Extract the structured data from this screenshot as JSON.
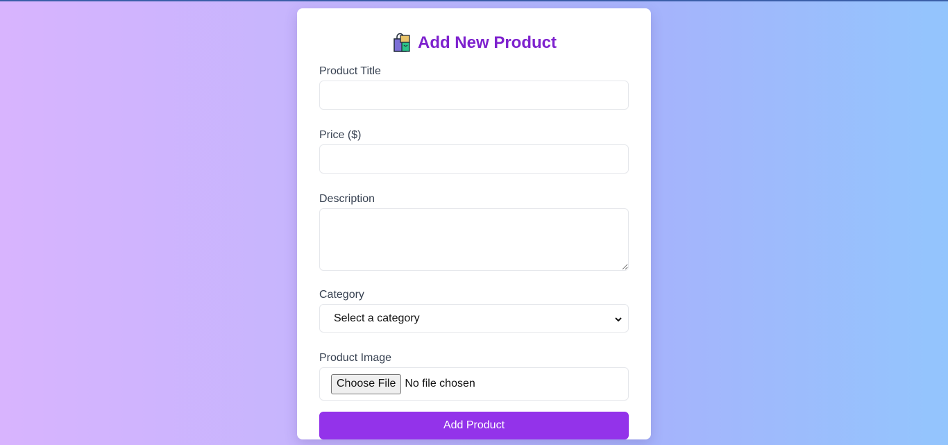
{
  "page": {
    "accent_color": "#9333ea",
    "title_color": "#7e22ce"
  },
  "form": {
    "title": "Add New Product",
    "title_icon": "shopping-bags-icon",
    "product_title": {
      "label": "Product Title",
      "value": ""
    },
    "price": {
      "label": "Price ($)",
      "value": ""
    },
    "description": {
      "label": "Description",
      "value": ""
    },
    "category": {
      "label": "Category",
      "selected": "Select a category"
    },
    "image": {
      "label": "Product Image",
      "button": "Choose File",
      "status": "No file chosen"
    },
    "submit_label": "Add Product"
  }
}
